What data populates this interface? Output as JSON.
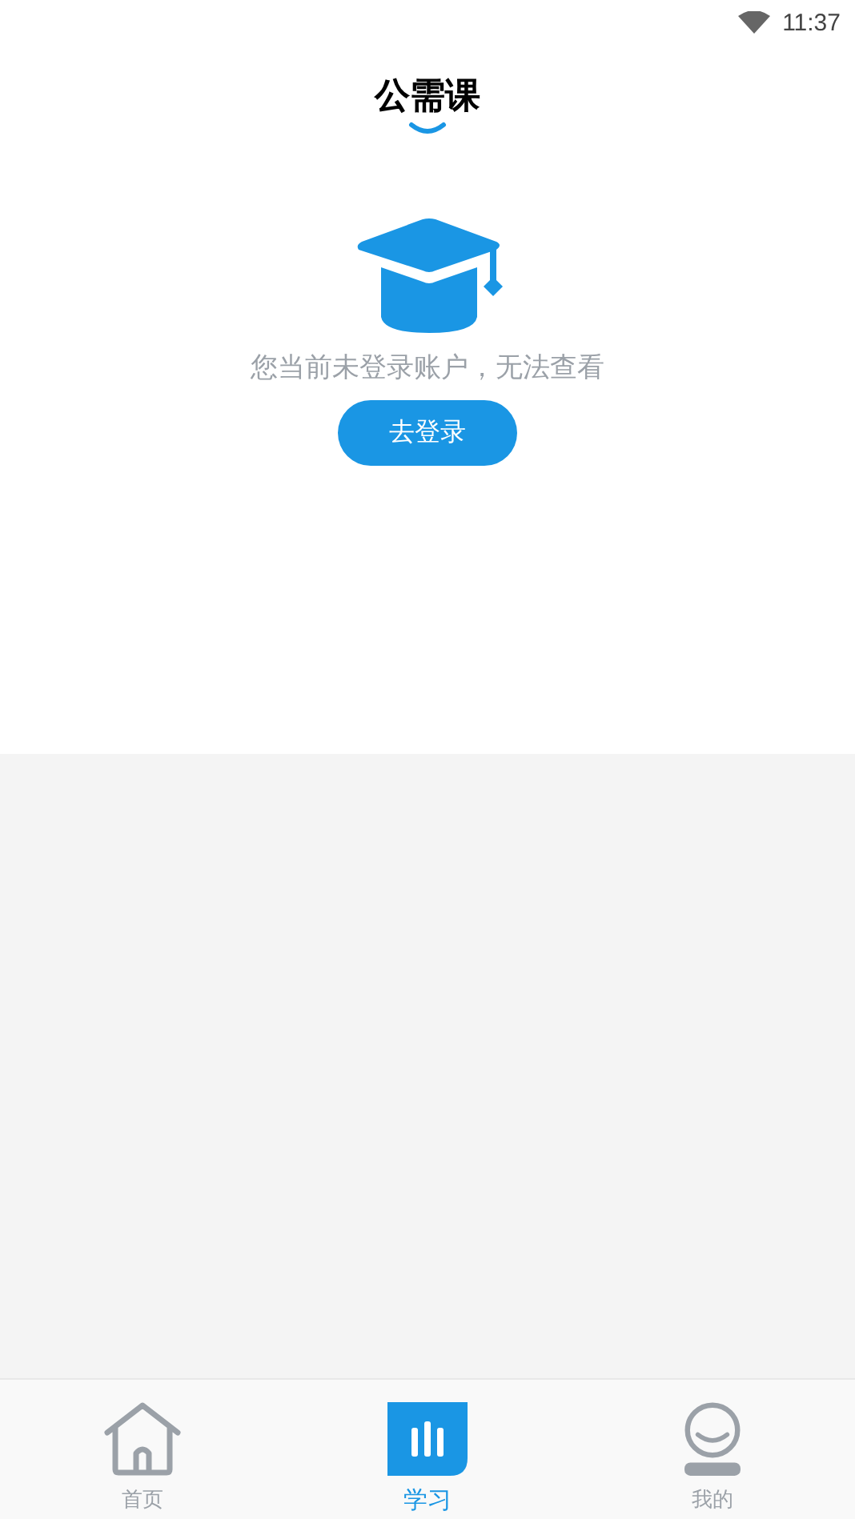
{
  "status_bar": {
    "time": "11:37"
  },
  "header": {
    "title": "公需课"
  },
  "empty_state": {
    "message": "您当前未登录账户，无法查看",
    "button": "去登录"
  },
  "tab_bar": [
    {
      "label": "首页",
      "kind": "home",
      "selected": false
    },
    {
      "label": "学习",
      "kind": "study",
      "selected": true
    },
    {
      "label": "我的",
      "kind": "profile",
      "selected": false
    }
  ]
}
